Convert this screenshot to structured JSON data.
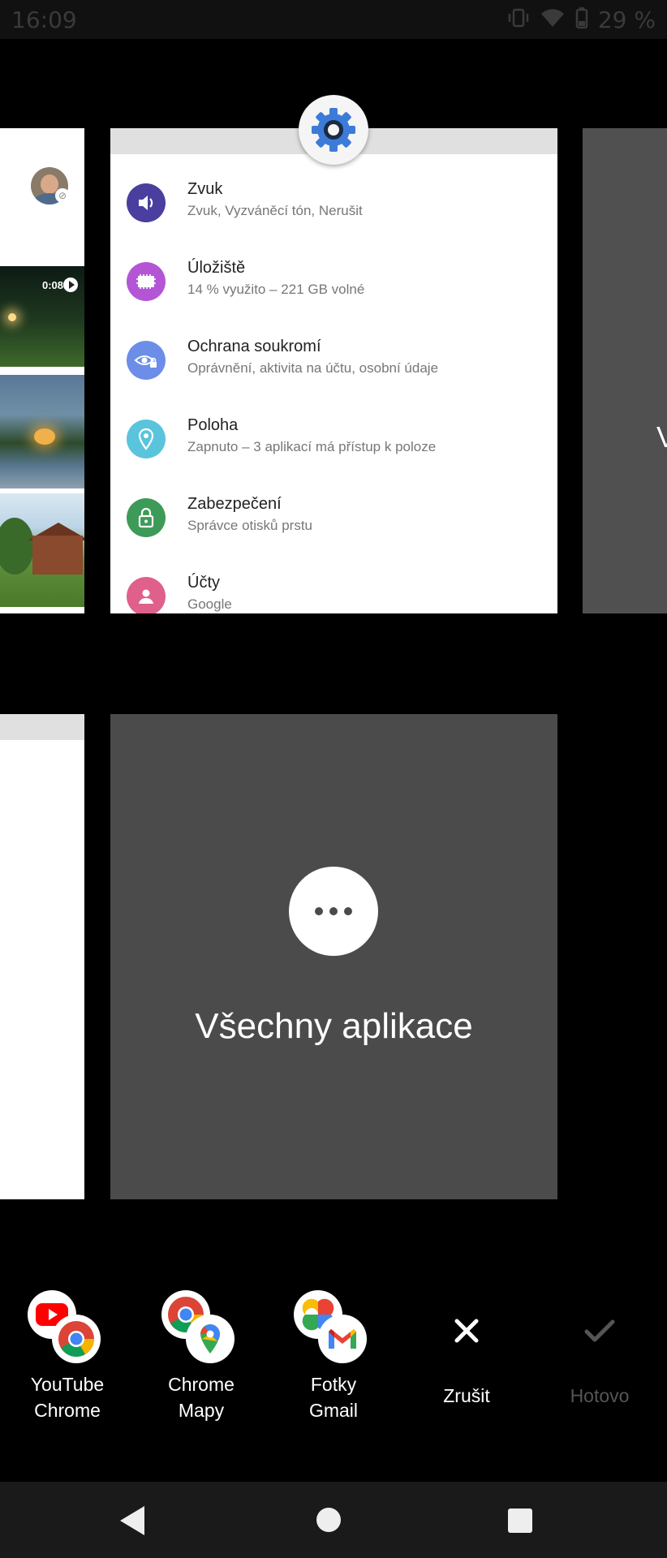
{
  "status_bar": {
    "time": "16:09",
    "battery": "29 %",
    "icons": [
      "vibrate-icon",
      "wifi-icon",
      "battery-icon"
    ]
  },
  "left_card_top": {
    "video_duration": "0:08"
  },
  "settings_card": {
    "items": [
      {
        "title": "Zvuk",
        "subtitle": "Zvuk, Vyzváněcí tón, Nerušit",
        "icon": "volume-icon",
        "color": "#4a3f9e"
      },
      {
        "title": "Úložiště",
        "subtitle": "14 % využito – 221 GB volné",
        "icon": "storage-icon",
        "color": "#b455d6"
      },
      {
        "title": "Ochrana soukromí",
        "subtitle": "Oprávnění, aktivita na účtu, osobní údaje",
        "icon": "privacy-eye-icon",
        "color": "#6c8ee8"
      },
      {
        "title": "Poloha",
        "subtitle": "Zapnuto – 3 aplikací má přístup k poloze",
        "icon": "location-icon",
        "color": "#5ac4dc"
      },
      {
        "title": "Zabezpečení",
        "subtitle": "Správce otisků prstu",
        "icon": "lock-icon",
        "color": "#3e9a58"
      },
      {
        "title": "Účty",
        "subtitle": "Google",
        "icon": "accounts-icon",
        "color": "#e0608c"
      }
    ]
  },
  "right_card_top": {
    "letter": "V"
  },
  "all_apps_card": {
    "label": "Všechny aplikace"
  },
  "bottom_bar": {
    "pairs": [
      {
        "line1": "YouTube",
        "line2": "Chrome",
        "icons": [
          "youtube-icon",
          "chrome-icon"
        ]
      },
      {
        "line1": "Chrome",
        "line2": "Mapy",
        "icons": [
          "chrome-icon",
          "maps-icon"
        ]
      },
      {
        "line1": "Fotky",
        "line2": "Gmail",
        "icons": [
          "photos-icon",
          "gmail-icon"
        ]
      }
    ],
    "cancel_label": "Zrušit",
    "done_label": "Hotovo"
  },
  "colors": {
    "background": "#000000",
    "card_dark": "#4b4b4b",
    "settings_blue": "#3d7bd8",
    "disabled": "#555555"
  }
}
